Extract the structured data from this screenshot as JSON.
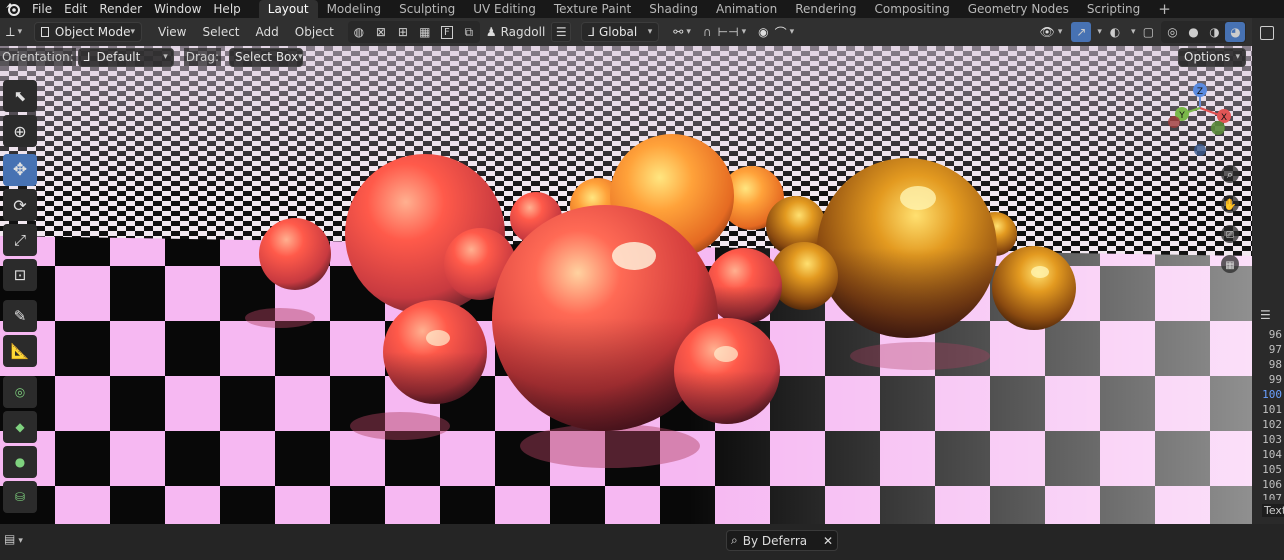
{
  "menu": [
    "File",
    "Edit",
    "Render",
    "Window",
    "Help"
  ],
  "workspaces": [
    "Layout",
    "Modeling",
    "Sculpting",
    "UV Editing",
    "Texture Paint",
    "Shading",
    "Animation",
    "Rendering",
    "Compositing",
    "Geometry Nodes",
    "Scripting"
  ],
  "active_workspace": "Layout",
  "add_workspace": "+",
  "header": {
    "mode": "Object Mode",
    "view": "View",
    "select": "Select",
    "add": "Add",
    "object": "Object",
    "snap_letter": "F",
    "addon": "Ragdoll",
    "transform_orientation": "Global"
  },
  "tool_settings": {
    "orientation_label": "Orientation:",
    "orientation_value": "Default",
    "drag_label": "Drag:",
    "drag_value": "Select Box",
    "options": "Options"
  },
  "gizmo": {
    "x": "X",
    "y": "Y",
    "z": "Z"
  },
  "timeline": {
    "frames": [
      "96",
      "97",
      "98",
      "99",
      "100",
      "101",
      "102",
      "103",
      "104",
      "105",
      "106",
      "107"
    ],
    "current": "100",
    "text_label": "Text"
  },
  "status": {
    "filter_text": "By Deferra"
  },
  "colors": {
    "accent": "#4772b3",
    "header": "#303030",
    "topbar": "#181818",
    "checker_pink": "#f6b8f2"
  }
}
